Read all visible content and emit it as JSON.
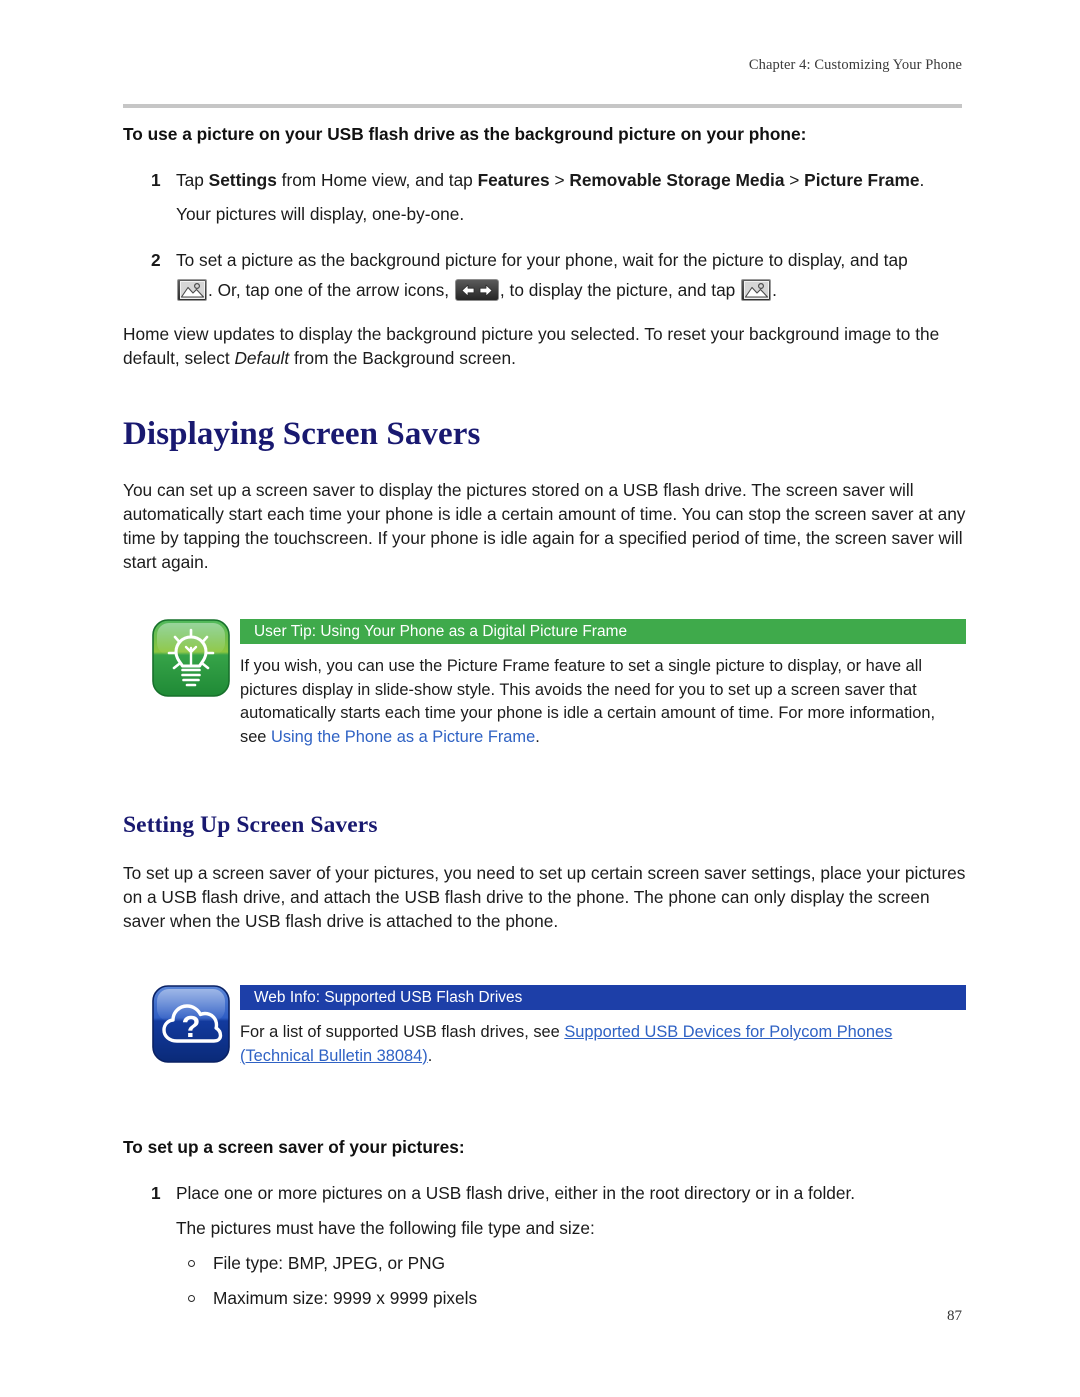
{
  "header": {
    "chapter": "Chapter 4: Customizing Your Phone"
  },
  "section_usb_background": {
    "lead": "To use a picture on your USB flash drive as the background picture on your phone:",
    "steps": [
      {
        "num": "1",
        "text_parts": [
          {
            "t": "Tap ",
            "style": "normal"
          },
          {
            "t": "Settings",
            "style": "bold"
          },
          {
            "t": " from Home view, and tap ",
            "style": "normal"
          },
          {
            "t": "Features",
            "style": "bold"
          },
          {
            "t": " > ",
            "style": "normal"
          },
          {
            "t": "Removable Storage Media",
            "style": "bold"
          },
          {
            "t": " > ",
            "style": "normal"
          },
          {
            "t": "Picture Frame",
            "style": "bold"
          },
          {
            "t": ".",
            "style": "normal"
          }
        ],
        "plain": "Tap Settings from Home view, and tap Features > Removable Storage Media > Picture Frame.",
        "continuation": "Your pictures will display, one-by-one."
      },
      {
        "num": "2",
        "plain_line1": "To set a picture as the background picture for your phone, wait for the picture to display, and tap",
        "line2_a": ". Or, tap one of the arrow icons,",
        "line2_b": ", to display the picture, and tap",
        "line2_c": ".",
        "icons": [
          "picture-frame-icon",
          "left-right-arrows-icon",
          "picture-frame-icon"
        ]
      }
    ],
    "closing": "Home view updates to display the background picture you selected. To reset your background image to the default, select Default from the Background screen.",
    "closing_a": "Home view updates to display the background picture you selected. To reset your background image to the default, select ",
    "closing_italic": "Default",
    "closing_b": " from the Background screen."
  },
  "section_displaying": {
    "heading": "Displaying Screen Savers",
    "paragraph": "You can set up a screen saver to display the pictures stored on a USB flash drive. The screen saver will automatically start each time your phone is idle a certain amount of time. You can stop the screen saver at any time by tapping the touchscreen. If your phone is idle again for a specified period of time, the screen saver will start again."
  },
  "user_tip_callout": {
    "icon": "lightbulb-icon",
    "icon_color": "#3faa4b",
    "bar_color": "#3faa4b",
    "title": "User Tip: Using Your Phone as a Digital Picture Frame",
    "body_before_link": "If you wish, you can use the Picture Frame feature to set a single picture to display, or have all pictures display in slide-show style. This avoids the need for you to set up a screen saver that automatically starts each time your phone is idle a certain amount of time. For more information, see ",
    "link_text": "Using the Phone as a Picture Frame",
    "body_after_link": ".",
    "link_color": "#2f62c4"
  },
  "section_setting_up": {
    "heading": "Setting Up Screen Savers",
    "paragraph": "To set up a screen saver of your pictures, you need to set up certain screen saver settings, place your pictures on a USB flash drive, and attach the USB flash drive to the phone. The phone can only display the screen saver when the USB flash drive is attached to the phone."
  },
  "web_info_callout": {
    "icon": "cloud-question-icon",
    "icon_color": "#1d3fa8",
    "bar_color": "#1d3fa8",
    "title": "Web Info: Supported USB Flash Drives",
    "body_before_link": "For a list of supported USB flash drives, see ",
    "link_text": "Supported USB Devices for Polycom Phones (Technical Bulletin 38084)",
    "body_after_link": ".",
    "link_color": "#2f62c4"
  },
  "section_setup_procedure": {
    "lead": "To set up a screen saver of your pictures:",
    "step_num": "1",
    "step_text": "Place one or more pictures on a USB flash drive, either in the root directory or in a folder.",
    "step_continuation": "The pictures must have the following file type and size:",
    "bullets": [
      "File type: BMP, JPEG, or PNG",
      "Maximum size: 9999 x 9999 pixels"
    ]
  },
  "footer": {
    "page_number": "87"
  }
}
